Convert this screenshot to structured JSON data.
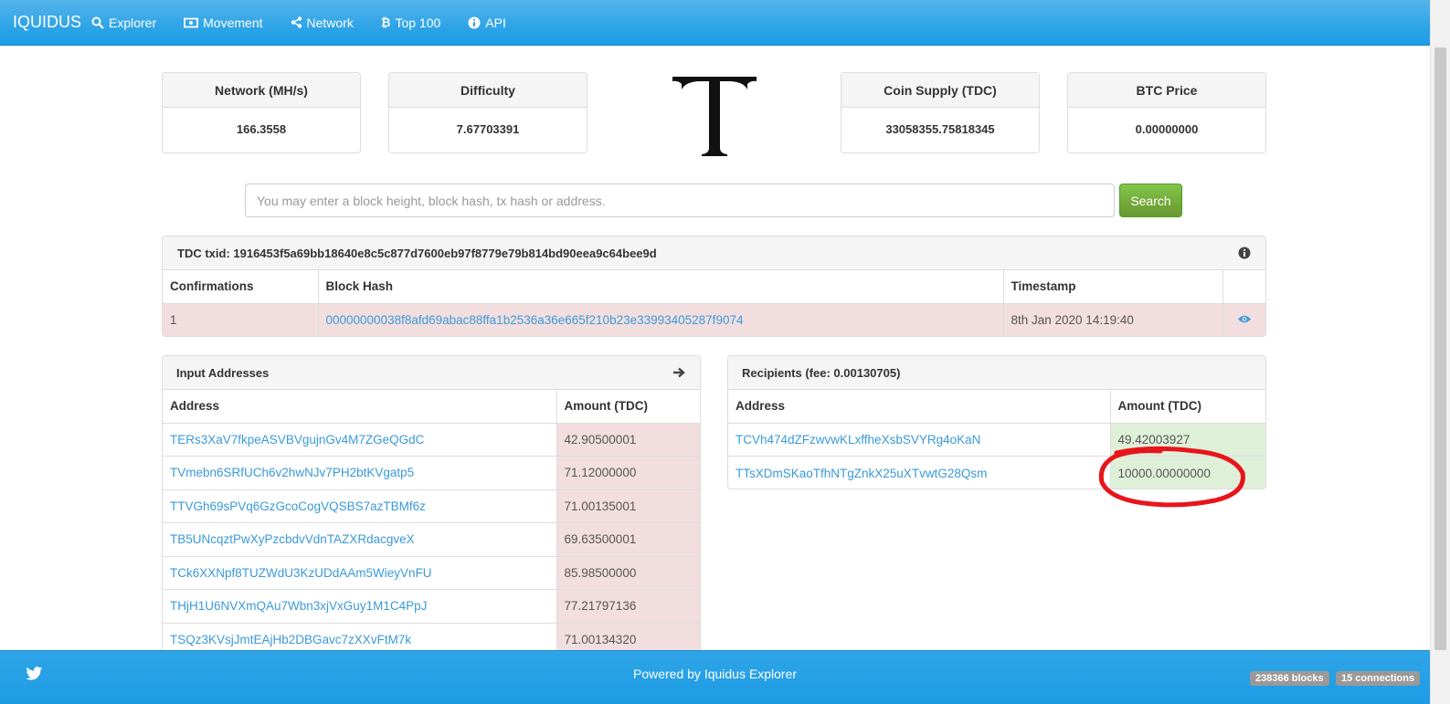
{
  "brand": "IQUIDUS",
  "nav": {
    "explorer": "Explorer",
    "movement": "Movement",
    "network": "Network",
    "top100": "Top 100",
    "api": "API"
  },
  "stats": {
    "network": {
      "label": "Network (MH/s)",
      "value": "166.3558"
    },
    "difficulty": {
      "label": "Difficulty",
      "value": "7.67703391"
    },
    "supply": {
      "label": "Coin Supply (TDC)",
      "value": "33058355.75818345"
    },
    "btc_price": {
      "label": "BTC Price",
      "value": "0.00000000"
    }
  },
  "logo_letter": "T",
  "search": {
    "placeholder": "You may enter a block height, block hash, tx hash or address.",
    "button": "Search"
  },
  "tx": {
    "title": "TDC txid: 1916453f5a69bb18640e8c5c877d7600eb97f8779e79b814bd90eea9c64bee9d",
    "headers": {
      "confirmations": "Confirmations",
      "block_hash": "Block Hash",
      "timestamp": "Timestamp"
    },
    "confirmations": "1",
    "block_hash": "00000000038f8afd69abac88ffa1b2536a36e665f210b23e33993405287f9074",
    "timestamp": "8th Jan 2020 14:19:40"
  },
  "inputs": {
    "title": "Input Addresses",
    "headers": {
      "address": "Address",
      "amount": "Amount (TDC)"
    },
    "rows": [
      {
        "address": "TERs3XaV7fkpeASVBVgujnGv4M7ZGeQGdC",
        "amount": "42.90500001"
      },
      {
        "address": "TVmebn6SRfUCh6v2hwNJv7PH2btKVgatp5",
        "amount": "71.12000000"
      },
      {
        "address": "TTVGh69sPVq6GzGcoCogVQSBS7azTBMf6z",
        "amount": "71.00135001"
      },
      {
        "address": "TB5UNcqztPwXyPzcbdvVdnTAZXRdacgveX",
        "amount": "69.63500001"
      },
      {
        "address": "TCk6XXNpf8TUZWdU3KzUDdAAm5WieyVnFU",
        "amount": "85.98500000"
      },
      {
        "address": "THjH1U6NVXmQAu7Wbn3xjVxGuy1M1C4PpJ",
        "amount": "77.21797136"
      },
      {
        "address": "TSQz3KVsjJmtEAjHb2DBGavc7zXXvFtM7k",
        "amount": "71.00134320"
      }
    ]
  },
  "recipients": {
    "title": "Recipients (fee: 0.00130705)",
    "headers": {
      "address": "Address",
      "amount": "Amount (TDC)"
    },
    "rows": [
      {
        "address": "TCVh474dZFzwvwKLxffheXsbSVYRg4oKaN",
        "amount": "49.42003927"
      },
      {
        "address": "TTsXDmSKaoTfhNTgZnkX25uXTvwtG28Qsm",
        "amount": "10000.00000000"
      }
    ]
  },
  "footer": {
    "powered": "Powered by Iquidus Explorer",
    "blocks": "238366 blocks",
    "connections": "15 connections"
  },
  "colors": {
    "navbar": "#2fa4e7",
    "link": "#3a9ad9",
    "danger_row": "#f2dede",
    "success_cell": "#dff0d8",
    "search_button": "#73a839",
    "annotation": "#e8141c"
  }
}
